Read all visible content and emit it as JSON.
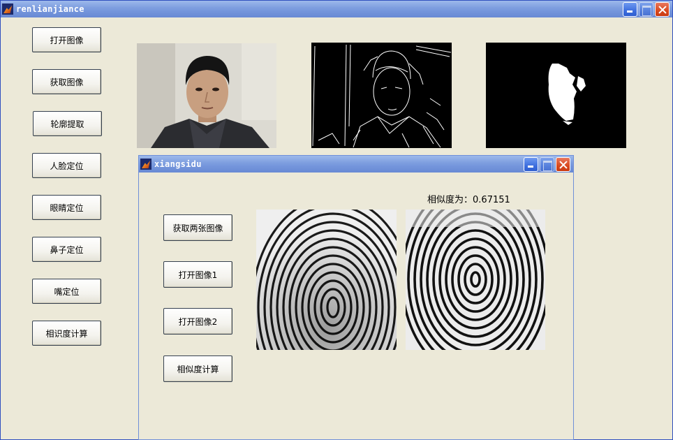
{
  "main_window": {
    "title": "renlianjiance",
    "buttons": [
      {
        "label": "打开图像"
      },
      {
        "label": "获取图像"
      },
      {
        "label": "轮廓提取"
      },
      {
        "label": "人脸定位"
      },
      {
        "label": "眼睛定位"
      },
      {
        "label": "鼻子定位"
      },
      {
        "label": "嘴定位"
      },
      {
        "label": "相识度计算"
      }
    ]
  },
  "sub_window": {
    "title": "xiangsidu",
    "buttons": [
      {
        "label": "获取两张图像"
      },
      {
        "label": "打开图像1"
      },
      {
        "label": "打开图像2"
      },
      {
        "label": "相似度计算"
      }
    ],
    "similarity_label": "相似度为：",
    "similarity_value": "0.67151"
  },
  "colors": {
    "window_bg": "#ece9d8",
    "titlebar": "#7596dc",
    "close_button": "#d9491f"
  }
}
